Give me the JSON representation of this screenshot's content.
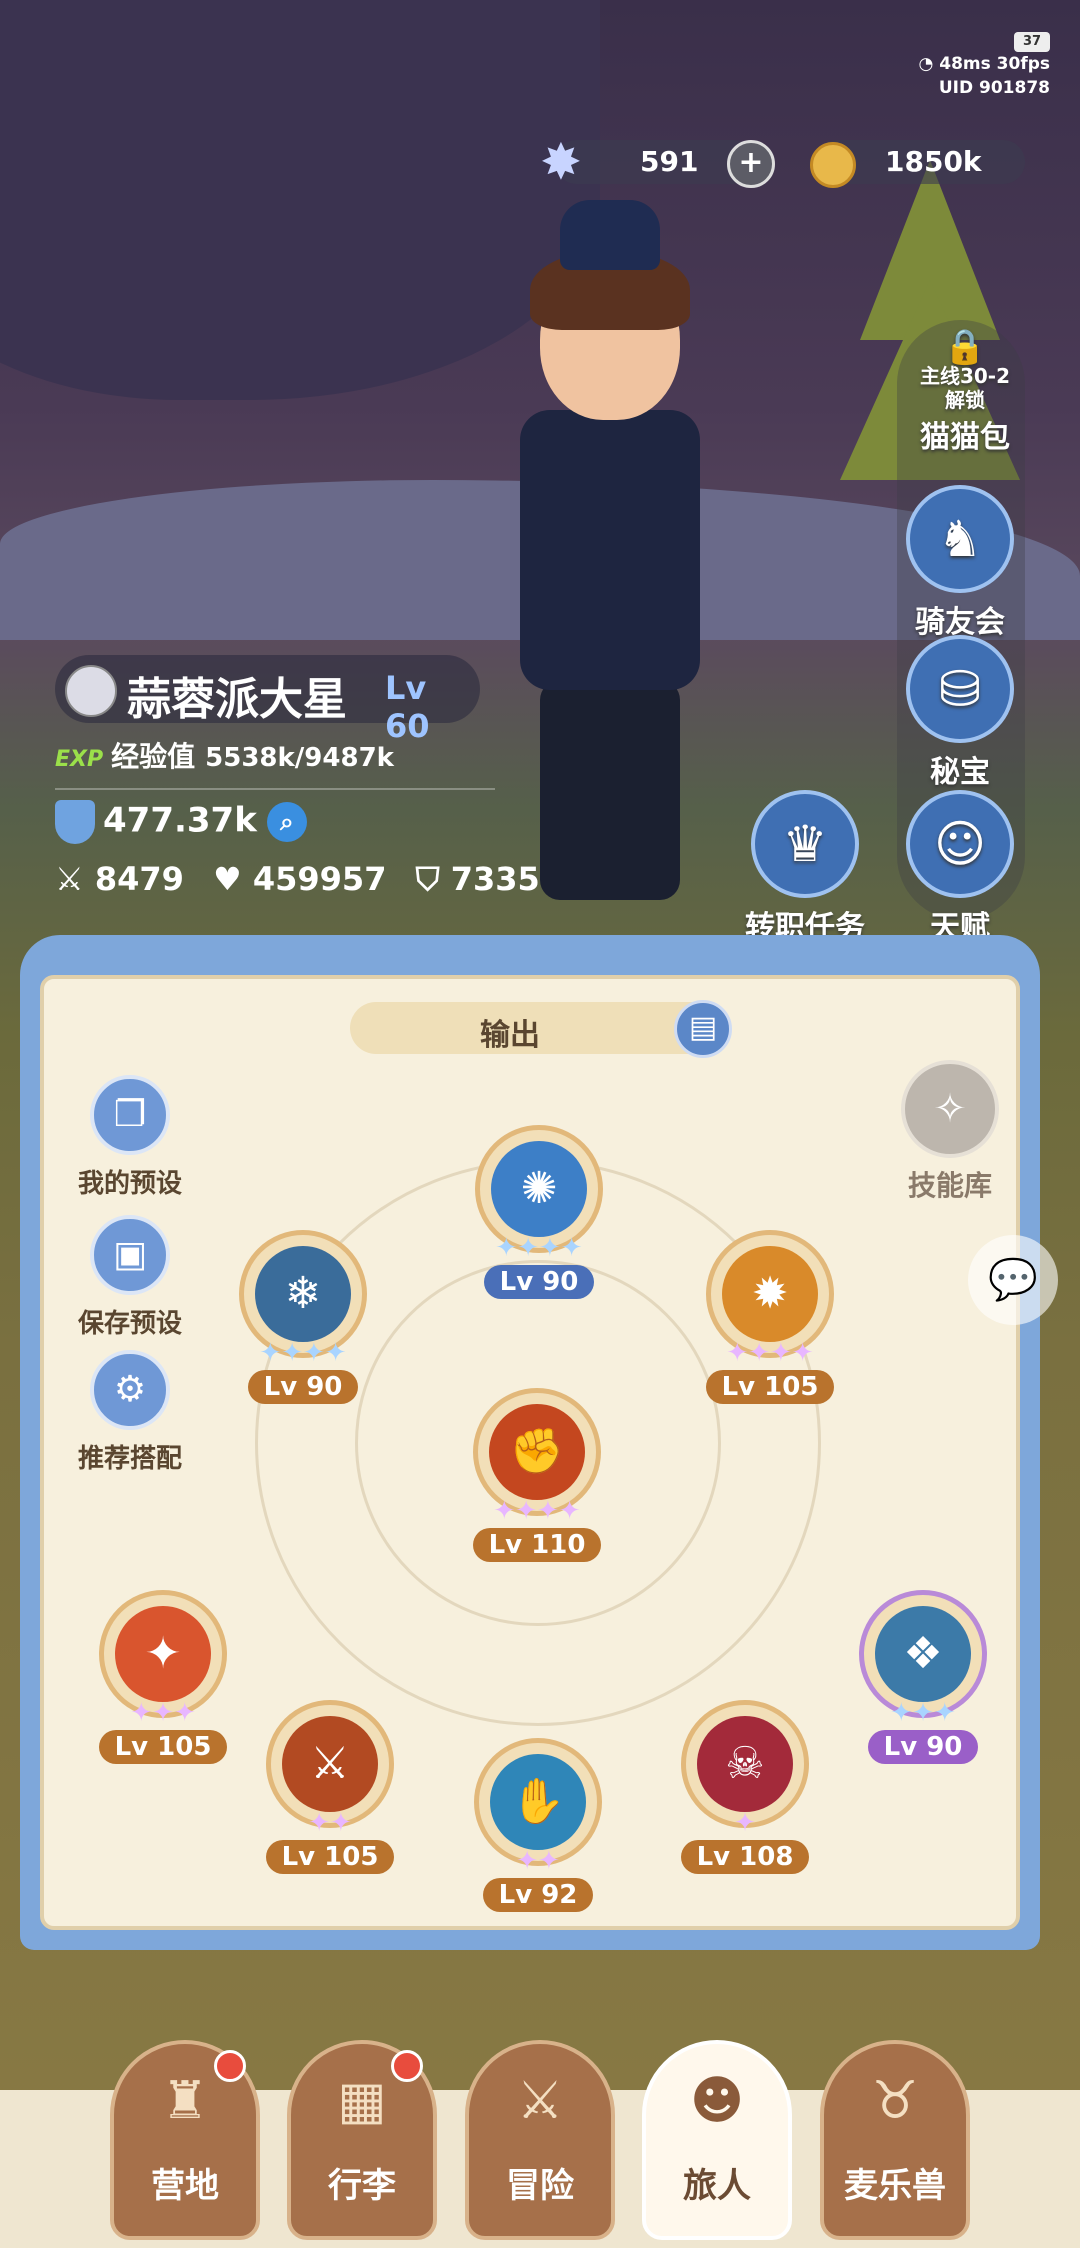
{
  "status": {
    "ping": "48ms",
    "fps": "30fps",
    "battery": "37",
    "uid": "UID 901878"
  },
  "currency": {
    "gems": "591",
    "gold": "1850k"
  },
  "side": {
    "lock_line1": "主线30-2",
    "lock_line2": "解锁",
    "cat_bag": "猫猫包",
    "rider_club": "骑友会",
    "treasure": "秘宝",
    "talent": "天赋",
    "job_quest": "转职任务"
  },
  "player": {
    "name": "蒜蓉派大星",
    "level": "Lv 60",
    "exp_badge": "EXP",
    "exp_label": "经验值",
    "exp_values": "5538k/9487k",
    "power": "477.37k",
    "attack": "8479",
    "hp": "459957",
    "defense": "7335"
  },
  "panel": {
    "tab_label": "输出",
    "presets": {
      "mine": "我的预设",
      "save": "保存预设",
      "recommend": "推荐搭配"
    },
    "skill_library": "技能库",
    "skills": [
      {
        "level": "Lv 90",
        "stars": "✦✦✦✦",
        "color": "#4a6fb8"
      },
      {
        "level": "Lv 90",
        "stars": "✦✦✦✦",
        "color": "#b9732d"
      },
      {
        "level": "Lv 105",
        "stars": "✦✦✦✦",
        "color": "#b9732d"
      },
      {
        "level": "Lv 110",
        "stars": "✦✦✦✦",
        "color": "#b9732d"
      },
      {
        "level": "Lv 105",
        "stars": "✦✦✦",
        "color": "#b9732d"
      },
      {
        "level": "Lv 90",
        "stars": "✦✦✦",
        "color": "#9a5fc8"
      },
      {
        "level": "Lv 105",
        "stars": "✦✦",
        "color": "#b9732d"
      },
      {
        "level": "Lv 92",
        "stars": "✦✦",
        "color": "#b9732d"
      },
      {
        "level": "Lv 108",
        "stars": "✦",
        "color": "#b9732d"
      }
    ]
  },
  "nav": {
    "camp": "营地",
    "luggage": "行李",
    "adventure": "冒险",
    "traveler": "旅人",
    "pets": "麦乐兽"
  }
}
